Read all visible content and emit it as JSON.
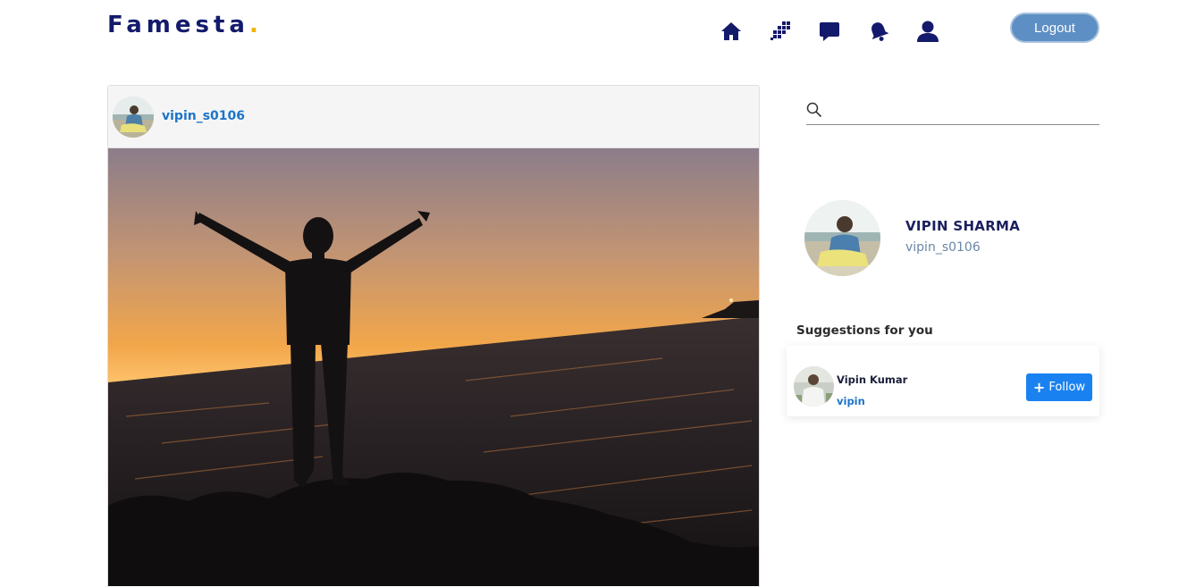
{
  "header": {
    "logo_text": "Famesta",
    "logo_dot": ".",
    "logout_label": "Logout",
    "nav_icons": [
      "home-icon",
      "explore-icon",
      "messages-icon",
      "notifications-icon",
      "profile-icon"
    ]
  },
  "post": {
    "username": "vipin_s0106",
    "image_subject": "silhouette-at-sunset"
  },
  "search": {
    "placeholder": "",
    "value": ""
  },
  "profile": {
    "name": "VIPIN SHARMA",
    "handle": "vipin_s0106"
  },
  "suggestions": {
    "title": "Suggestions for you",
    "items": [
      {
        "name": "Vipin Kumar",
        "handle": "vipin",
        "button_label": "Follow"
      }
    ]
  },
  "colors": {
    "brand": "#141a6b",
    "accent": "#f2b300",
    "link": "#1d74c9",
    "logout_bg": "#5d8fc4",
    "follow_bg": "#1a82f0"
  }
}
